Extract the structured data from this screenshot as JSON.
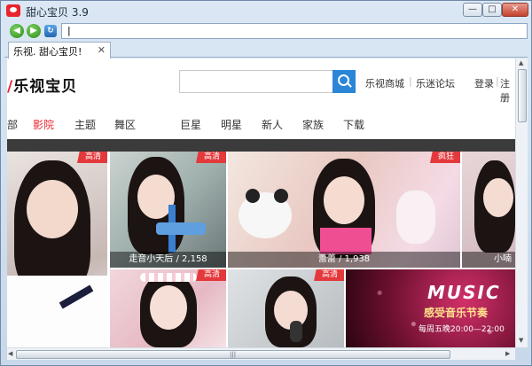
{
  "window": {
    "title": "甜心宝贝 3.9",
    "controls": {
      "minimize": "—",
      "maximize": "□",
      "close": "✕"
    }
  },
  "browser": {
    "back_icon": "back-arrow-icon",
    "forward_icon": "forward-arrow-icon",
    "refresh_icon": "refresh-icon",
    "address_value": "|"
  },
  "tabs": [
    {
      "label": "乐视. 甜心宝贝!",
      "close": "✕"
    }
  ],
  "site": {
    "logo_mark": "/",
    "logo_text": "乐视宝贝",
    "header_links": [
      "乐视商城",
      "乐迷论坛"
    ],
    "login": "登录",
    "register": "注册"
  },
  "categories": [
    {
      "label": "影院",
      "active": true
    },
    {
      "label": "主题"
    },
    {
      "label": "舞区"
    },
    {
      "label": "巨星"
    },
    {
      "label": "明星"
    },
    {
      "label": "新人"
    },
    {
      "label": "家族"
    },
    {
      "label": "下载"
    }
  ],
  "category_cut_prefix": "部",
  "thumbnails": [
    {
      "badge": "高清"
    },
    {
      "badge": "高清",
      "caption": "走音小天后 / 2,158"
    },
    {
      "badge": "疯狂",
      "caption": "蕾蕾 / 1,938"
    },
    {
      "caption": "小喃"
    },
    {
      "badge": "高清"
    },
    {
      "badge": "高清"
    },
    {}
  ],
  "promo": {
    "title": "MUSIC",
    "subtitle": "感受音乐节奏",
    "schedule": "每周五晚20:00—22:00"
  },
  "scrollbar": {
    "up": "▲",
    "down": "▼",
    "left": "◀",
    "right": "▶",
    "grip": "|||"
  }
}
